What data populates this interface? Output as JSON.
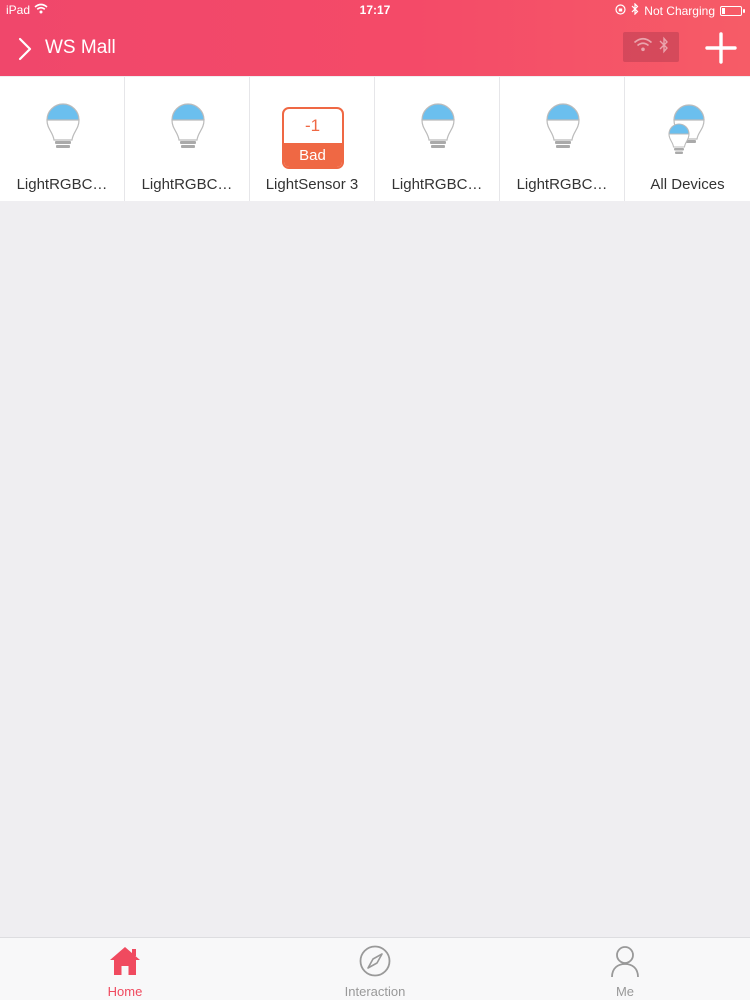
{
  "status_bar": {
    "device": "iPad",
    "time": "17:17",
    "charging": "Not Charging"
  },
  "navbar": {
    "title": "WS Mall"
  },
  "devices": [
    {
      "label": "LightRGBC…",
      "icon": "bulb-icon"
    },
    {
      "label": "LightRGBC…",
      "icon": "bulb-icon"
    },
    {
      "label": "LightSensor 3",
      "icon": "sensor-icon",
      "value": "-1",
      "quality": "Bad"
    },
    {
      "label": "LightRGBC…",
      "icon": "bulb-icon"
    },
    {
      "label": "LightRGBC…",
      "icon": "bulb-icon"
    },
    {
      "label": "All Devices",
      "icon": "all-devices-icon"
    }
  ],
  "tabs": [
    {
      "label": "Home",
      "icon": "home-icon",
      "active": true
    },
    {
      "label": "Interaction",
      "icon": "compass-icon",
      "active": false
    },
    {
      "label": "Me",
      "icon": "person-icon",
      "active": false
    }
  ],
  "colors": {
    "accent": "#f04a64",
    "bulb_top": "#6bbfee",
    "sensor": "#ef6844",
    "tab_active": "#f04a5f",
    "tab_inactive": "#999999"
  }
}
